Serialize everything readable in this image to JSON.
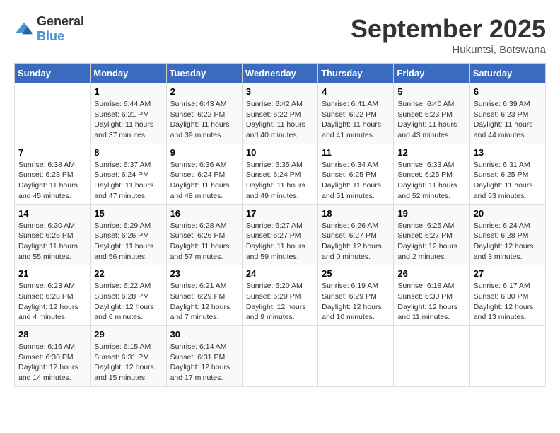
{
  "header": {
    "logo_general": "General",
    "logo_blue": "Blue",
    "month_year": "September 2025",
    "location": "Hukuntsi, Botswana"
  },
  "days_of_week": [
    "Sunday",
    "Monday",
    "Tuesday",
    "Wednesday",
    "Thursday",
    "Friday",
    "Saturday"
  ],
  "weeks": [
    [
      {
        "day": "",
        "info": ""
      },
      {
        "day": "1",
        "info": "Sunrise: 6:44 AM\nSunset: 6:21 PM\nDaylight: 11 hours\nand 37 minutes."
      },
      {
        "day": "2",
        "info": "Sunrise: 6:43 AM\nSunset: 6:22 PM\nDaylight: 11 hours\nand 39 minutes."
      },
      {
        "day": "3",
        "info": "Sunrise: 6:42 AM\nSunset: 6:22 PM\nDaylight: 11 hours\nand 40 minutes."
      },
      {
        "day": "4",
        "info": "Sunrise: 6:41 AM\nSunset: 6:22 PM\nDaylight: 11 hours\nand 41 minutes."
      },
      {
        "day": "5",
        "info": "Sunrise: 6:40 AM\nSunset: 6:23 PM\nDaylight: 11 hours\nand 43 minutes."
      },
      {
        "day": "6",
        "info": "Sunrise: 6:39 AM\nSunset: 6:23 PM\nDaylight: 11 hours\nand 44 minutes."
      }
    ],
    [
      {
        "day": "7",
        "info": "Sunrise: 6:38 AM\nSunset: 6:23 PM\nDaylight: 11 hours\nand 45 minutes."
      },
      {
        "day": "8",
        "info": "Sunrise: 6:37 AM\nSunset: 6:24 PM\nDaylight: 11 hours\nand 47 minutes."
      },
      {
        "day": "9",
        "info": "Sunrise: 6:36 AM\nSunset: 6:24 PM\nDaylight: 11 hours\nand 48 minutes."
      },
      {
        "day": "10",
        "info": "Sunrise: 6:35 AM\nSunset: 6:24 PM\nDaylight: 11 hours\nand 49 minutes."
      },
      {
        "day": "11",
        "info": "Sunrise: 6:34 AM\nSunset: 6:25 PM\nDaylight: 11 hours\nand 51 minutes."
      },
      {
        "day": "12",
        "info": "Sunrise: 6:33 AM\nSunset: 6:25 PM\nDaylight: 11 hours\nand 52 minutes."
      },
      {
        "day": "13",
        "info": "Sunrise: 6:31 AM\nSunset: 6:25 PM\nDaylight: 11 hours\nand 53 minutes."
      }
    ],
    [
      {
        "day": "14",
        "info": "Sunrise: 6:30 AM\nSunset: 6:26 PM\nDaylight: 11 hours\nand 55 minutes."
      },
      {
        "day": "15",
        "info": "Sunrise: 6:29 AM\nSunset: 6:26 PM\nDaylight: 11 hours\nand 56 minutes."
      },
      {
        "day": "16",
        "info": "Sunrise: 6:28 AM\nSunset: 6:26 PM\nDaylight: 11 hours\nand 57 minutes."
      },
      {
        "day": "17",
        "info": "Sunrise: 6:27 AM\nSunset: 6:27 PM\nDaylight: 11 hours\nand 59 minutes."
      },
      {
        "day": "18",
        "info": "Sunrise: 6:26 AM\nSunset: 6:27 PM\nDaylight: 12 hours\nand 0 minutes."
      },
      {
        "day": "19",
        "info": "Sunrise: 6:25 AM\nSunset: 6:27 PM\nDaylight: 12 hours\nand 2 minutes."
      },
      {
        "day": "20",
        "info": "Sunrise: 6:24 AM\nSunset: 6:28 PM\nDaylight: 12 hours\nand 3 minutes."
      }
    ],
    [
      {
        "day": "21",
        "info": "Sunrise: 6:23 AM\nSunset: 6:28 PM\nDaylight: 12 hours\nand 4 minutes."
      },
      {
        "day": "22",
        "info": "Sunrise: 6:22 AM\nSunset: 6:28 PM\nDaylight: 12 hours\nand 6 minutes."
      },
      {
        "day": "23",
        "info": "Sunrise: 6:21 AM\nSunset: 6:29 PM\nDaylight: 12 hours\nand 7 minutes."
      },
      {
        "day": "24",
        "info": "Sunrise: 6:20 AM\nSunset: 6:29 PM\nDaylight: 12 hours\nand 9 minutes."
      },
      {
        "day": "25",
        "info": "Sunrise: 6:19 AM\nSunset: 6:29 PM\nDaylight: 12 hours\nand 10 minutes."
      },
      {
        "day": "26",
        "info": "Sunrise: 6:18 AM\nSunset: 6:30 PM\nDaylight: 12 hours\nand 11 minutes."
      },
      {
        "day": "27",
        "info": "Sunrise: 6:17 AM\nSunset: 6:30 PM\nDaylight: 12 hours\nand 13 minutes."
      }
    ],
    [
      {
        "day": "28",
        "info": "Sunrise: 6:16 AM\nSunset: 6:30 PM\nDaylight: 12 hours\nand 14 minutes."
      },
      {
        "day": "29",
        "info": "Sunrise: 6:15 AM\nSunset: 6:31 PM\nDaylight: 12 hours\nand 15 minutes."
      },
      {
        "day": "30",
        "info": "Sunrise: 6:14 AM\nSunset: 6:31 PM\nDaylight: 12 hours\nand 17 minutes."
      },
      {
        "day": "",
        "info": ""
      },
      {
        "day": "",
        "info": ""
      },
      {
        "day": "",
        "info": ""
      },
      {
        "day": "",
        "info": ""
      }
    ]
  ]
}
